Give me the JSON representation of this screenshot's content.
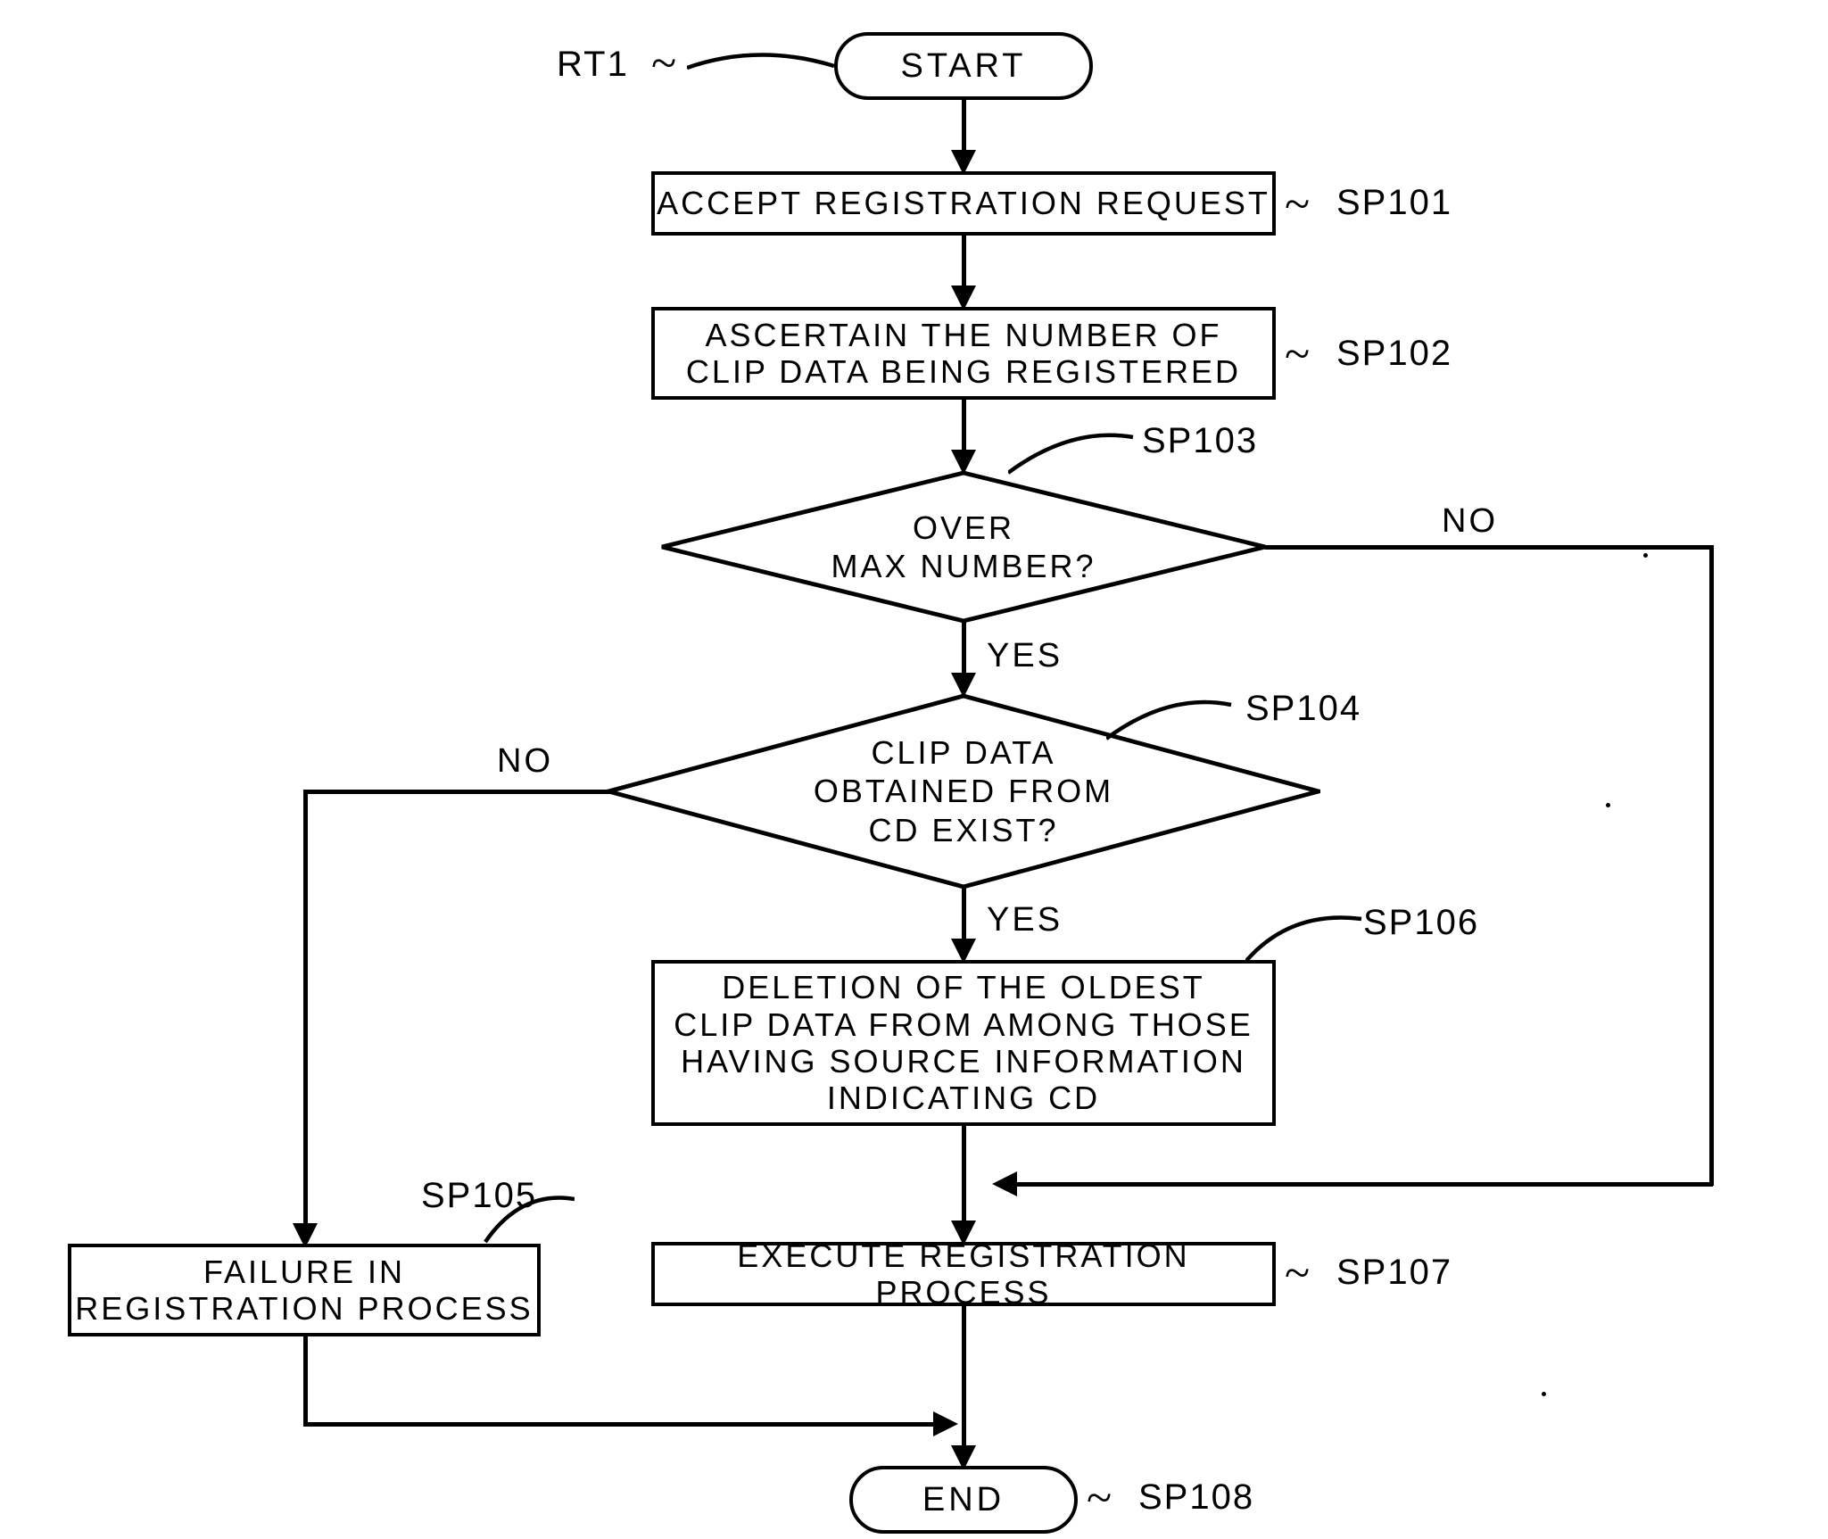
{
  "terminators": {
    "start": "START",
    "end": "END"
  },
  "processes": {
    "sp101": "ACCEPT REGISTRATION REQUEST",
    "sp102": "ASCERTAIN THE NUMBER OF\nCLIP DATA BEING REGISTERED",
    "sp105": "FAILURE IN\nREGISTRATION PROCESS",
    "sp106": "DELETION OF THE OLDEST\nCLIP DATA FROM AMONG THOSE\nHAVING SOURCE INFORMATION\nINDICATING CD",
    "sp107": "EXECUTE REGISTRATION PROCESS"
  },
  "decisions": {
    "sp103": "OVER\nMAX NUMBER?",
    "sp104": "CLIP DATA\nOBTAINED FROM\nCD EXIST?"
  },
  "labels": {
    "rt1": "RT1",
    "sp101": "SP101",
    "sp102": "SP102",
    "sp103": "SP103",
    "sp104": "SP104",
    "sp105": "SP105",
    "sp106": "SP106",
    "sp107": "SP107",
    "sp108": "SP108"
  },
  "edge_labels": {
    "yes": "YES",
    "no": "NO"
  }
}
